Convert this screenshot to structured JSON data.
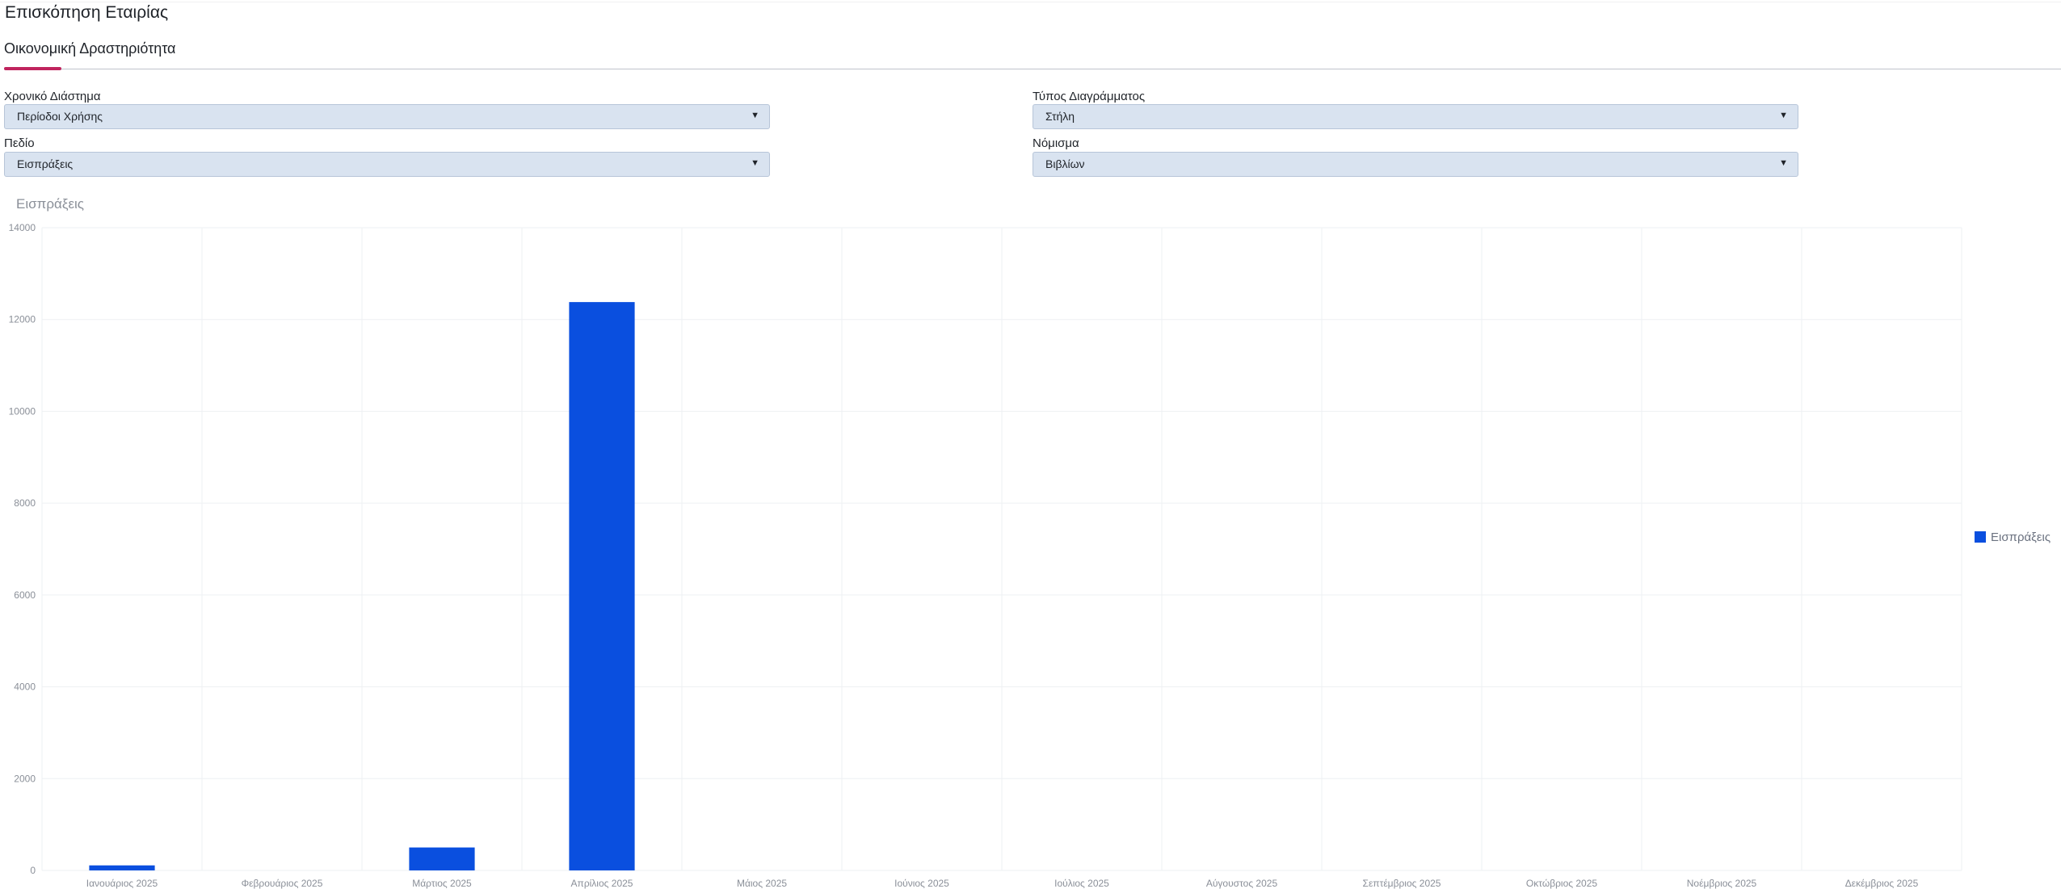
{
  "page": {
    "title": "Επισκόπηση Εταιρίας"
  },
  "tabs": [
    {
      "label": "Οικονομική Δραστηριότητα",
      "active": true
    }
  ],
  "filters": {
    "period": {
      "label": "Χρονικό Διάστημα",
      "value": "Περίοδοι Χρήσης"
    },
    "chart_type": {
      "label": "Τύπος Διαγράμματος",
      "value": "Στήλη"
    },
    "field": {
      "label": "Πεδίο",
      "value": "Εισπράξεις"
    },
    "currency": {
      "label": "Νόμισμα",
      "value": "Βιβλίων"
    }
  },
  "colors": {
    "accent": "#c0245e",
    "bar": "#0a4fdf",
    "select_bg": "#d9e3f0",
    "axis_text": "#8a8f98",
    "grid": "#eef0f3"
  },
  "icons": {
    "dropdown": "caret-down-icon",
    "legend": "legend-swatch"
  },
  "chart_data": {
    "type": "bar",
    "title": "Εισπράξεις",
    "categories": [
      "Ιανουάριος 2025",
      "Φεβρουάριος 2025",
      "Μάρτιος 2025",
      "Απρίλιος 2025",
      "Μάιος 2025",
      "Ιούνιος 2025",
      "Ιούλιος 2025",
      "Αύγουστος 2025",
      "Σεπτέμβριος 2025",
      "Οκτώβριος 2025",
      "Νοέμβριος 2025",
      "Δεκέμβριος 2025"
    ],
    "series": [
      {
        "name": "Εισπράξεις",
        "values": [
          110,
          0,
          500,
          12380,
          0,
          0,
          0,
          0,
          0,
          0,
          0,
          0
        ]
      }
    ],
    "yticks": [
      "0",
      "2000",
      "4000",
      "6000",
      "8000",
      "10000",
      "12000",
      "14000"
    ],
    "ylim": [
      0,
      14000
    ],
    "grid": true,
    "legend_position": "right"
  }
}
